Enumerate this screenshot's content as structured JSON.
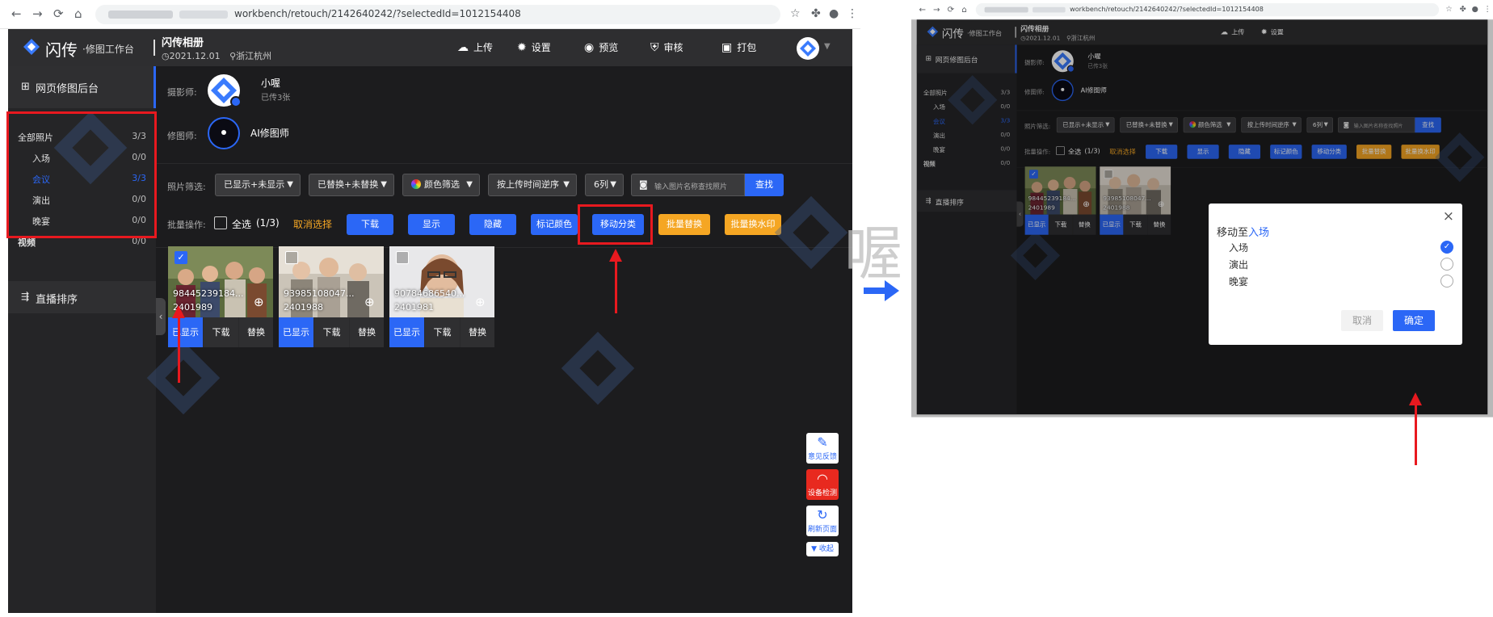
{
  "browser": {
    "nav": {
      "back": "←",
      "forward": "→",
      "reload": "⟳",
      "home": "⌂"
    },
    "url_suffix": "workbench/retouch/2142640242/?selectedId=1012154408",
    "icons": [
      "star-icon",
      "extension-icon",
      "profile-icon",
      "menu-icon"
    ]
  },
  "header": {
    "logo_text": "闪传",
    "logo_sub": "·修图工作台",
    "album_title": "闪传相册",
    "album_date": "2021.12.01",
    "album_location": "浙江杭州",
    "actions_left": [
      {
        "icon": "☁",
        "label": "上传"
      },
      {
        "icon": "✹",
        "label": "设置"
      },
      {
        "icon": "◉",
        "label": "预览"
      },
      {
        "icon": "⛨",
        "label": "审核"
      },
      {
        "icon": "▣",
        "label": "打包"
      }
    ],
    "actions_right": [
      {
        "icon": "☁",
        "label": "上传"
      },
      {
        "icon": "✹",
        "label": "设置"
      }
    ]
  },
  "sidebar": {
    "title": "网页修图后台",
    "live": "直播排序",
    "items": [
      {
        "label": "全部照片",
        "count": "3/3"
      },
      {
        "label": "入场",
        "count": "0/0"
      },
      {
        "label": "会议",
        "count": "3/3"
      },
      {
        "label": "演出",
        "count": "0/0"
      },
      {
        "label": "晚宴",
        "count": "0/0"
      },
      {
        "label": "视频",
        "count": "0/0"
      }
    ]
  },
  "photographer": {
    "label": "摄影师:",
    "name": "小喔",
    "sub": "已传3张"
  },
  "retoucher": {
    "label": "修图师:",
    "name": "AI修图师"
  },
  "filters": {
    "label": "照片筛选:",
    "dropdowns": [
      "已显示+未显示",
      "已替换+未替换",
      "颜色筛选",
      "按上传时间逆序",
      "6列"
    ],
    "search_placeholder": "输入图片名称查找照片",
    "search_button": "查找"
  },
  "batch": {
    "label": "批量操作:",
    "select_all": "全选",
    "select_count": "(1/3)",
    "cancel": "取消选择",
    "buttons": [
      "下载",
      "显示",
      "隐藏",
      "标记颜色",
      "移动分类",
      "批量替换",
      "批量换水印"
    ]
  },
  "photos": [
    {
      "name": "98445239184...",
      "id": "2401989",
      "checked": true,
      "actions": [
        "已显示",
        "下载",
        "替换"
      ]
    },
    {
      "name": "93985108047...",
      "id": "2401988",
      "checked": false,
      "actions": [
        "已显示",
        "下载",
        "替换"
      ]
    },
    {
      "name": "90784686540...",
      "id": "2401981",
      "checked": false,
      "actions": [
        "已显示",
        "下载",
        "替换"
      ]
    }
  ],
  "float_buttons": [
    {
      "icon": "✎",
      "label": "意见反馈"
    },
    {
      "icon": "◠",
      "label": "设备检测"
    },
    {
      "icon": "↻",
      "label": "刷新页面"
    }
  ],
  "float_collapse": "▼ 收起",
  "watermark_char": "喔",
  "dialog": {
    "title_prefix": "移动至",
    "title_target": "入场",
    "options": [
      {
        "label": "入场",
        "selected": true
      },
      {
        "label": "演出",
        "selected": false
      },
      {
        "label": "晚宴",
        "selected": false
      }
    ],
    "cancel": "取消",
    "confirm": "确定",
    "close": "×"
  },
  "colors": {
    "accent": "#2b67f6",
    "orange": "#f5a623",
    "annotation_red": "#e8191f",
    "bg": "#1c1c1e"
  }
}
